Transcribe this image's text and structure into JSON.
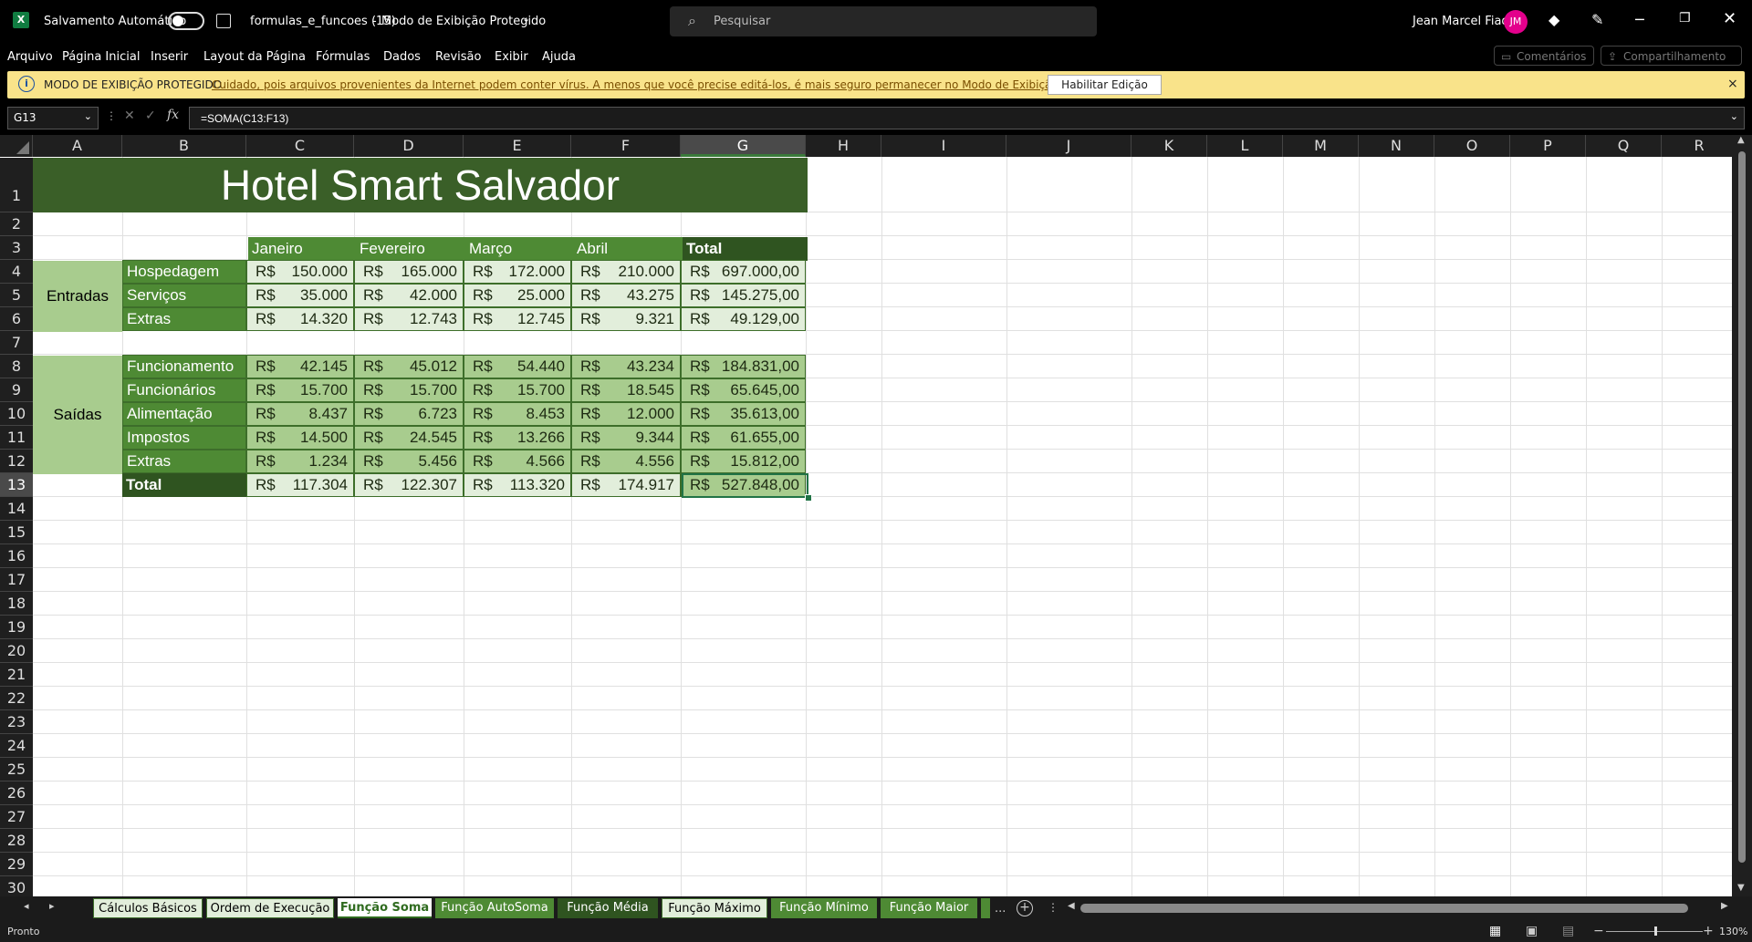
{
  "titlebar": {
    "app_icon": "excel-icon",
    "autosave_label": "Salvamento Automático",
    "autosave_state": "off",
    "file_name": "formulas_e_funcoes (15)",
    "separator": "-",
    "mode": "Modo de Exibição Protegido",
    "search_placeholder": "Pesquisar",
    "user_name": "Jean Marcel Fiad",
    "user_initials": "JM"
  },
  "menu": {
    "items": [
      "Arquivo",
      "Página Inicial",
      "Inserir",
      "Layout da Página",
      "Fórmulas",
      "Dados",
      "Revisão",
      "Exibir",
      "Ajuda"
    ],
    "comments": "Comentários",
    "share": "Compartilhamento"
  },
  "banner": {
    "label": "MODO DE EXIBIÇÃO PROTEGIDO",
    "message": "Cuidado, pois arquivos provenientes da Internet podem conter vírus. A menos que você precise editá-los, é mais seguro permanecer no Modo de  Exibição Protegido.",
    "enable_button": "Habilitar Edição",
    "close": "×"
  },
  "formula_bar": {
    "name_box": "G13",
    "fx": "fx",
    "formula": "=SOMA(C13:F13)"
  },
  "grid": {
    "columns": [
      "A",
      "B",
      "C",
      "D",
      "E",
      "F",
      "G",
      "H",
      "I",
      "J",
      "K",
      "L",
      "M",
      "N",
      "O",
      "P",
      "Q",
      "R"
    ],
    "selected_column": "G",
    "rows": [
      "1",
      "2",
      "3",
      "4",
      "5",
      "6",
      "7",
      "8",
      "9",
      "10",
      "11",
      "12",
      "13",
      "14",
      "15",
      "16",
      "17",
      "18",
      "19",
      "20",
      "21",
      "22",
      "23",
      "24",
      "25",
      "26",
      "27",
      "28",
      "29",
      "30"
    ],
    "selected_row": "13"
  },
  "sheet": {
    "title": "Hotel Smart Salvador",
    "months": [
      "Janeiro",
      "Fevereiro",
      "Março",
      "Abril"
    ],
    "total_header": "Total",
    "currency": "R$",
    "entradas_label": "Entradas",
    "saidas_label": "Saídas",
    "entradas": [
      {
        "label": "Hospedagem",
        "values": [
          "150.000",
          "165.000",
          "172.000",
          "210.000"
        ],
        "total": "697.000,00"
      },
      {
        "label": "Serviços",
        "values": [
          "35.000",
          "42.000",
          "25.000",
          "43.275"
        ],
        "total": "145.275,00"
      },
      {
        "label": "Extras",
        "values": [
          "14.320",
          "12.743",
          "12.745",
          "9.321"
        ],
        "total": "49.129,00"
      }
    ],
    "saidas": [
      {
        "label": "Funcionamento",
        "values": [
          "42.145",
          "45.012",
          "54.440",
          "43.234"
        ],
        "total": "184.831,00"
      },
      {
        "label": "Funcionários",
        "values": [
          "15.700",
          "15.700",
          "15.700",
          "18.545"
        ],
        "total": "65.645,00"
      },
      {
        "label": "Alimentação",
        "values": [
          "8.437",
          "6.723",
          "8.453",
          "12.000"
        ],
        "total": "35.613,00"
      },
      {
        "label": "Impostos",
        "values": [
          "14.500",
          "24.545",
          "13.266",
          "9.344"
        ],
        "total": "61.655,00"
      },
      {
        "label": "Extras",
        "values": [
          "1.234",
          "5.456",
          "4.566",
          "4.556"
        ],
        "total": "15.812,00"
      }
    ],
    "total_row": {
      "label": "Total",
      "values": [
        "117.304",
        "122.307",
        "113.320",
        "174.917"
      ],
      "total": "527.848,00"
    }
  },
  "tabs": {
    "items": [
      "Cálculos Básicos",
      "Ordem de Execução",
      "Função Soma",
      "Função AutoSoma",
      "Função Média",
      "Função Máximo",
      "Função Mínimo",
      "Função Maior"
    ],
    "active": "Função Soma",
    "more": "...",
    "add": "+"
  },
  "status": {
    "ready": "Pronto",
    "zoom": "130%"
  },
  "colors": {
    "title_green": "#3a5f28",
    "header_green": "#4e8a34",
    "dark_green": "#2f5420",
    "light_green": "#e2eedb",
    "medium_green": "#a8cc8e",
    "banner_yellow": "#f9e38a",
    "avatar_pink": "#e3008c"
  }
}
